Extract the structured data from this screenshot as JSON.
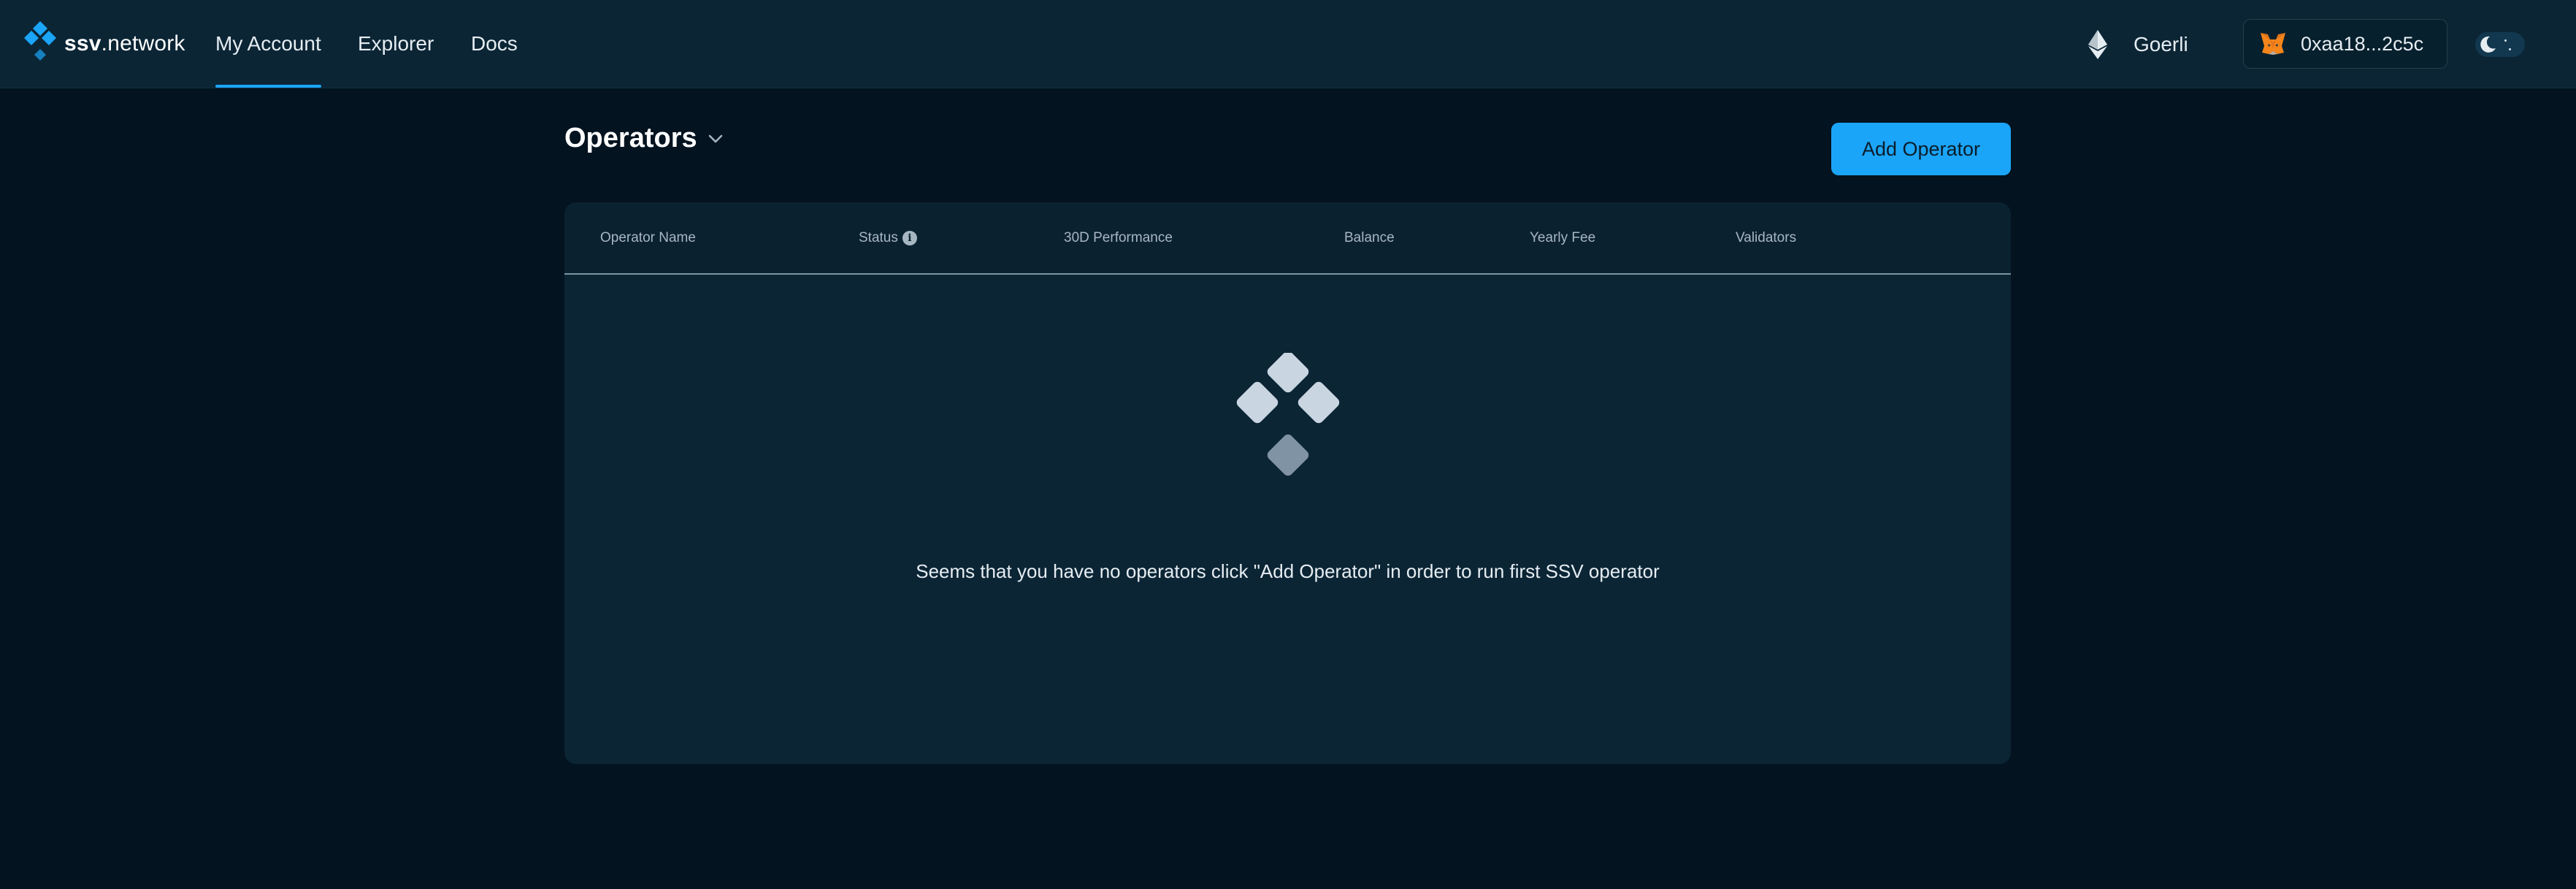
{
  "brand": {
    "name_bold": "ssv",
    "name_rest": ".network",
    "accent": "#1ba5f8"
  },
  "nav": {
    "items": [
      {
        "label": "My Account",
        "active": true
      },
      {
        "label": "Explorer",
        "active": false
      },
      {
        "label": "Docs",
        "active": false
      }
    ]
  },
  "network": {
    "icon": "ethereum-icon",
    "label": "Goerli"
  },
  "wallet": {
    "icon": "metamask-fox-icon",
    "address": "0xaa18...2c5c"
  },
  "theme_toggle": {
    "icon": "moon-icon",
    "mode": "dark"
  },
  "page": {
    "title": "Operators",
    "add_button_label": "Add Operator"
  },
  "table": {
    "columns": [
      "Operator Name",
      "Status",
      "30D Performance",
      "Balance",
      "Yearly Fee",
      "Validators"
    ],
    "rows": [],
    "empty_message": "Seems that you have no operators click \"Add Operator\" in order to run first SSV operator"
  },
  "colors": {
    "page_bg": "#03131f",
    "topbar_bg": "#0b2535",
    "card_bg": "#0b2535",
    "header_text": "#a7b7c2"
  }
}
